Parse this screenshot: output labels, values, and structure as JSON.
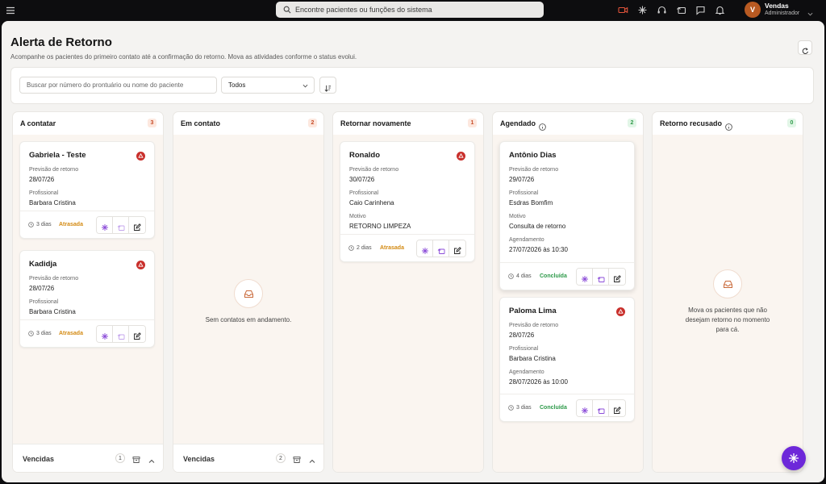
{
  "search": {
    "placeholder": "Encontre pacientes ou funções do sistema"
  },
  "user": {
    "initial": "V",
    "name": "Vendas",
    "role": "Administrador"
  },
  "page": {
    "title": "Alerta de Retorno",
    "subtitle": "Acompanhe os pacientes do primeiro contato até a confirmação do retorno. Mova as atividades conforme o status evolui."
  },
  "filters": {
    "search_placeholder": "Buscar por número do prontuário ou nome do paciente",
    "select_value": "Todos"
  },
  "columns": [
    {
      "title": "A contatar",
      "count": "3",
      "cards": [
        {
          "name": "Gabriela - Teste",
          "fields": [
            {
              "label": "Previsão de retorno",
              "value": "28/07/26"
            },
            {
              "label": "Profissional",
              "value": "Barbara Cristina"
            }
          ],
          "days": "3 dias",
          "status": "Atrasada"
        },
        {
          "name": "Kadidja",
          "fields": [
            {
              "label": "Previsão de retorno",
              "value": "28/07/26"
            },
            {
              "label": "Profissional",
              "value": "Barbara Cristina"
            }
          ],
          "days": "3 dias",
          "status": "Atrasada"
        }
      ],
      "vencidas": {
        "label": "Vencidas",
        "count": "1"
      }
    },
    {
      "title": "Em contato",
      "count": "2",
      "empty": "Sem contatos em andamento.",
      "vencidas": {
        "label": "Vencidas",
        "count": "2"
      }
    },
    {
      "title": "Retornar novamente",
      "count": "1",
      "cards": [
        {
          "name": "Ronaldo",
          "fields": [
            {
              "label": "Previsão de retorno",
              "value": "30/07/26"
            },
            {
              "label": "Profissional",
              "value": "Caio Carinhena"
            },
            {
              "label": "Motivo",
              "value": "RETORNO LIMPEZA"
            }
          ],
          "days": "2 dias",
          "status": "Atrasada"
        }
      ]
    },
    {
      "title": "Agendado",
      "count": "2",
      "cards": [
        {
          "name": "Antônio Dias",
          "fields": [
            {
              "label": "Previsão de retorno",
              "value": "29/07/26"
            },
            {
              "label": "Profissional",
              "value": "Esdras Bomfim"
            },
            {
              "label": "Motivo",
              "value": "Consulta de retorno"
            },
            {
              "label": "Agendamento",
              "value": "27/07/2026 às 10:30"
            }
          ],
          "days": "4 dias",
          "status": "Concluída"
        },
        {
          "name": "Paloma Lima",
          "fields": [
            {
              "label": "Previsão de retorno",
              "value": "28/07/26"
            },
            {
              "label": "Profissional",
              "value": "Barbara Cristina"
            },
            {
              "label": "Agendamento",
              "value": "28/07/2026 às 10:00"
            }
          ],
          "days": "3 dias",
          "status": "Concluída"
        }
      ]
    },
    {
      "title": "Retorno recusado",
      "count": "0",
      "empty": "Mova os pacientes que não desejam retorno no momento para cá."
    }
  ],
  "colors": {
    "accent": "#6d28d9",
    "late": "#d38a12",
    "done": "#2e9a4a",
    "alert": "#c9302c"
  }
}
